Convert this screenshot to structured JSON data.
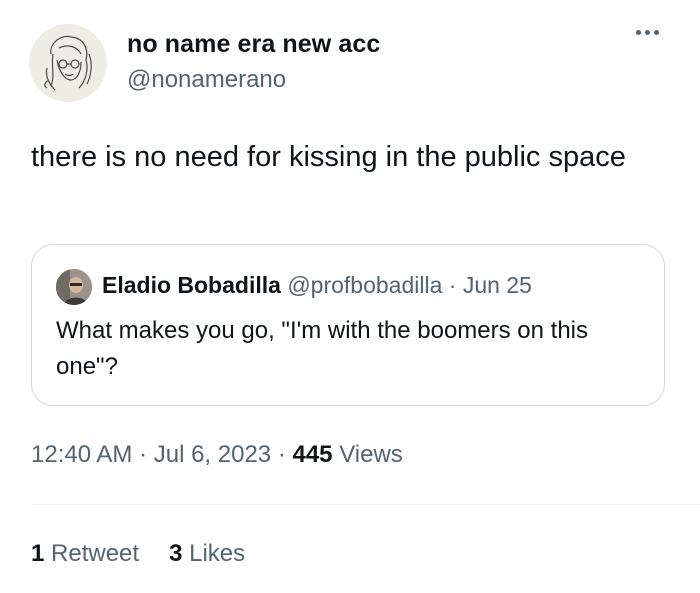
{
  "author": {
    "display_name": "no name era new acc",
    "handle": "@nonamerano"
  },
  "tweet": {
    "text": "there is no need for kissing in the public space"
  },
  "quoted_tweet": {
    "display_name": "Eladio Bobadilla",
    "handle": "@profbobadilla",
    "separator": " · ",
    "date": "Jun 25",
    "text": "What makes you go, \"I'm with the boomers on this one\"?"
  },
  "meta": {
    "time": "12:40 AM",
    "separator": " · ",
    "date": "Jul 6, 2023",
    "separator2": " · ",
    "views_count": "445",
    "views_label": " Views"
  },
  "stats": {
    "retweets_count": "1",
    "retweets_label": " Retweet",
    "likes_count": "3",
    "likes_label": " Likes"
  },
  "icons": {
    "more": "more-options-icon"
  }
}
